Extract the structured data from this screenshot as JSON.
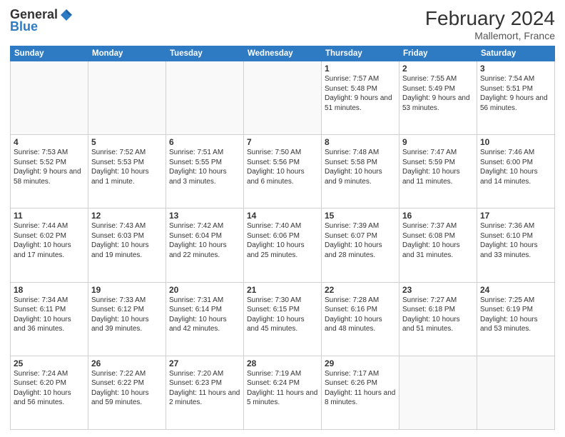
{
  "header": {
    "logo": {
      "general": "General",
      "blue": "Blue"
    },
    "month_year": "February 2024",
    "location": "Mallemort, France"
  },
  "weekdays": [
    "Sunday",
    "Monday",
    "Tuesday",
    "Wednesday",
    "Thursday",
    "Friday",
    "Saturday"
  ],
  "weeks": [
    [
      {
        "day": "",
        "info": ""
      },
      {
        "day": "",
        "info": ""
      },
      {
        "day": "",
        "info": ""
      },
      {
        "day": "",
        "info": ""
      },
      {
        "day": "1",
        "info": "Sunrise: 7:57 AM\nSunset: 5:48 PM\nDaylight: 9 hours and 51 minutes."
      },
      {
        "day": "2",
        "info": "Sunrise: 7:55 AM\nSunset: 5:49 PM\nDaylight: 9 hours and 53 minutes."
      },
      {
        "day": "3",
        "info": "Sunrise: 7:54 AM\nSunset: 5:51 PM\nDaylight: 9 hours and 56 minutes."
      }
    ],
    [
      {
        "day": "4",
        "info": "Sunrise: 7:53 AM\nSunset: 5:52 PM\nDaylight: 9 hours and 58 minutes."
      },
      {
        "day": "5",
        "info": "Sunrise: 7:52 AM\nSunset: 5:53 PM\nDaylight: 10 hours and 1 minute."
      },
      {
        "day": "6",
        "info": "Sunrise: 7:51 AM\nSunset: 5:55 PM\nDaylight: 10 hours and 3 minutes."
      },
      {
        "day": "7",
        "info": "Sunrise: 7:50 AM\nSunset: 5:56 PM\nDaylight: 10 hours and 6 minutes."
      },
      {
        "day": "8",
        "info": "Sunrise: 7:48 AM\nSunset: 5:58 PM\nDaylight: 10 hours and 9 minutes."
      },
      {
        "day": "9",
        "info": "Sunrise: 7:47 AM\nSunset: 5:59 PM\nDaylight: 10 hours and 11 minutes."
      },
      {
        "day": "10",
        "info": "Sunrise: 7:46 AM\nSunset: 6:00 PM\nDaylight: 10 hours and 14 minutes."
      }
    ],
    [
      {
        "day": "11",
        "info": "Sunrise: 7:44 AM\nSunset: 6:02 PM\nDaylight: 10 hours and 17 minutes."
      },
      {
        "day": "12",
        "info": "Sunrise: 7:43 AM\nSunset: 6:03 PM\nDaylight: 10 hours and 19 minutes."
      },
      {
        "day": "13",
        "info": "Sunrise: 7:42 AM\nSunset: 6:04 PM\nDaylight: 10 hours and 22 minutes."
      },
      {
        "day": "14",
        "info": "Sunrise: 7:40 AM\nSunset: 6:06 PM\nDaylight: 10 hours and 25 minutes."
      },
      {
        "day": "15",
        "info": "Sunrise: 7:39 AM\nSunset: 6:07 PM\nDaylight: 10 hours and 28 minutes."
      },
      {
        "day": "16",
        "info": "Sunrise: 7:37 AM\nSunset: 6:08 PM\nDaylight: 10 hours and 31 minutes."
      },
      {
        "day": "17",
        "info": "Sunrise: 7:36 AM\nSunset: 6:10 PM\nDaylight: 10 hours and 33 minutes."
      }
    ],
    [
      {
        "day": "18",
        "info": "Sunrise: 7:34 AM\nSunset: 6:11 PM\nDaylight: 10 hours and 36 minutes."
      },
      {
        "day": "19",
        "info": "Sunrise: 7:33 AM\nSunset: 6:12 PM\nDaylight: 10 hours and 39 minutes."
      },
      {
        "day": "20",
        "info": "Sunrise: 7:31 AM\nSunset: 6:14 PM\nDaylight: 10 hours and 42 minutes."
      },
      {
        "day": "21",
        "info": "Sunrise: 7:30 AM\nSunset: 6:15 PM\nDaylight: 10 hours and 45 minutes."
      },
      {
        "day": "22",
        "info": "Sunrise: 7:28 AM\nSunset: 6:16 PM\nDaylight: 10 hours and 48 minutes."
      },
      {
        "day": "23",
        "info": "Sunrise: 7:27 AM\nSunset: 6:18 PM\nDaylight: 10 hours and 51 minutes."
      },
      {
        "day": "24",
        "info": "Sunrise: 7:25 AM\nSunset: 6:19 PM\nDaylight: 10 hours and 53 minutes."
      }
    ],
    [
      {
        "day": "25",
        "info": "Sunrise: 7:24 AM\nSunset: 6:20 PM\nDaylight: 10 hours and 56 minutes."
      },
      {
        "day": "26",
        "info": "Sunrise: 7:22 AM\nSunset: 6:22 PM\nDaylight: 10 hours and 59 minutes."
      },
      {
        "day": "27",
        "info": "Sunrise: 7:20 AM\nSunset: 6:23 PM\nDaylight: 11 hours and 2 minutes."
      },
      {
        "day": "28",
        "info": "Sunrise: 7:19 AM\nSunset: 6:24 PM\nDaylight: 11 hours and 5 minutes."
      },
      {
        "day": "29",
        "info": "Sunrise: 7:17 AM\nSunset: 6:26 PM\nDaylight: 11 hours and 8 minutes."
      },
      {
        "day": "",
        "info": ""
      },
      {
        "day": "",
        "info": ""
      }
    ]
  ]
}
